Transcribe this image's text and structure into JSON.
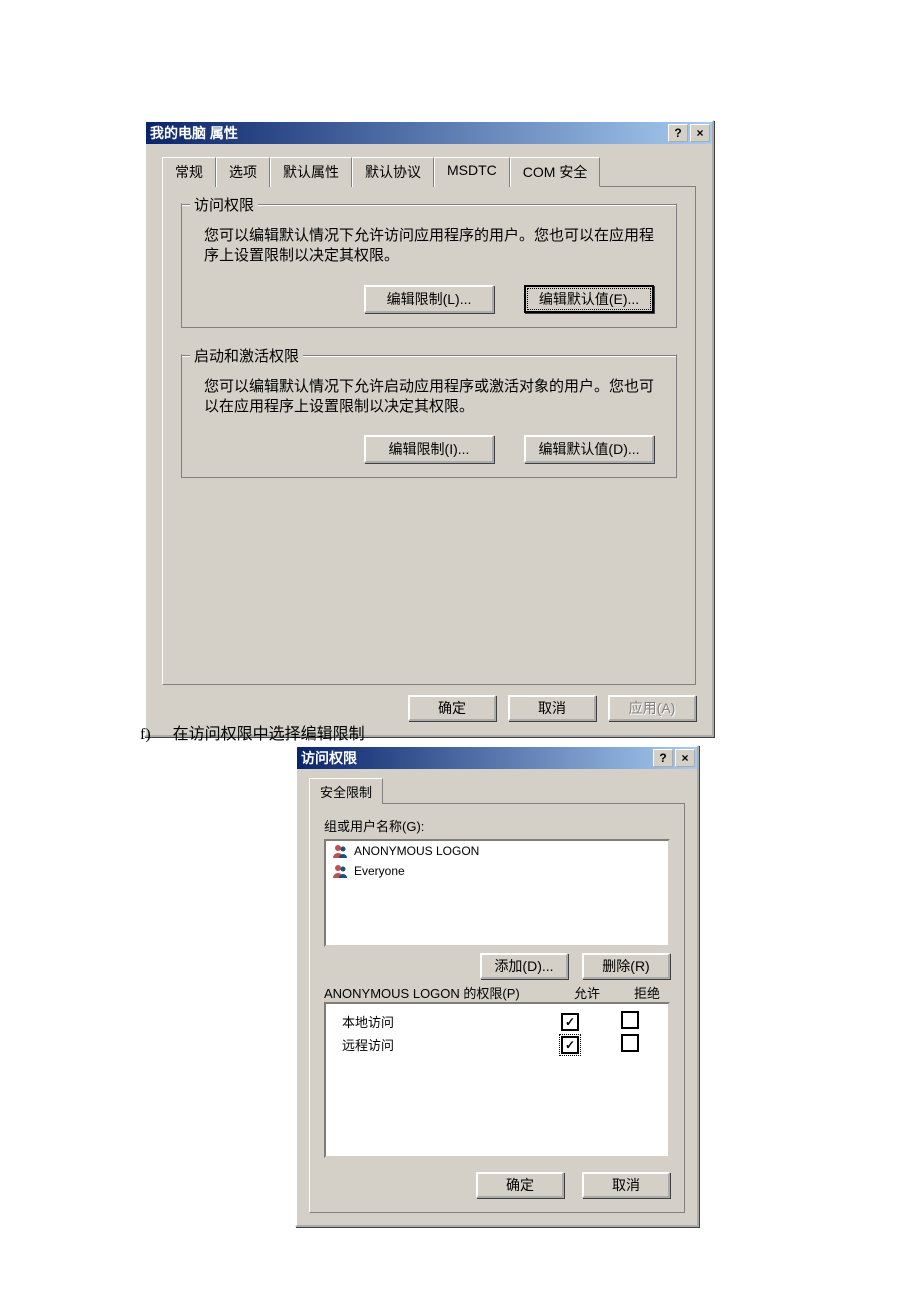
{
  "dialog1": {
    "title": "我的电脑 属性",
    "tabs": [
      "常规",
      "选项",
      "默认属性",
      "默认协议",
      "MSDTC",
      "COM 安全"
    ],
    "active_tab_index": 5,
    "access_group": {
      "legend": "访问权限",
      "desc": "您可以编辑默认情况下允许访问应用程序的用户。您也可以在应用程序上设置限制以决定其权限。",
      "btn_limit": "编辑限制(L)...",
      "btn_default": "编辑默认值(E)..."
    },
    "launch_group": {
      "legend": "启动和激活权限",
      "desc": "您可以编辑默认情况下允许启动应用程序或激活对象的用户。您也可以在应用程序上设置限制以决定其权限。",
      "btn_limit": "编辑限制(I)...",
      "btn_default": "编辑默认值(D)..."
    },
    "footer": {
      "ok": "确定",
      "cancel": "取消",
      "apply": "应用(A)"
    }
  },
  "caption": {
    "marker": "f)",
    "text": "在访问权限中选择编辑限制"
  },
  "dialog2": {
    "title": "访问权限",
    "tab": "安全限制",
    "group_label": "组或用户名称(G):",
    "users": [
      "ANONYMOUS LOGON",
      "Everyone"
    ],
    "btn_add": "添加(D)...",
    "btn_remove": "删除(R)",
    "perm_label": "ANONYMOUS LOGON 的权限(P)",
    "col_allow": "允许",
    "col_deny": "拒绝",
    "permissions": [
      {
        "name": "本地访问",
        "allow": true,
        "deny": false,
        "allow_focused": false
      },
      {
        "name": "远程访问",
        "allow": true,
        "deny": false,
        "allow_focused": true
      }
    ],
    "footer": {
      "ok": "确定",
      "cancel": "取消"
    }
  }
}
